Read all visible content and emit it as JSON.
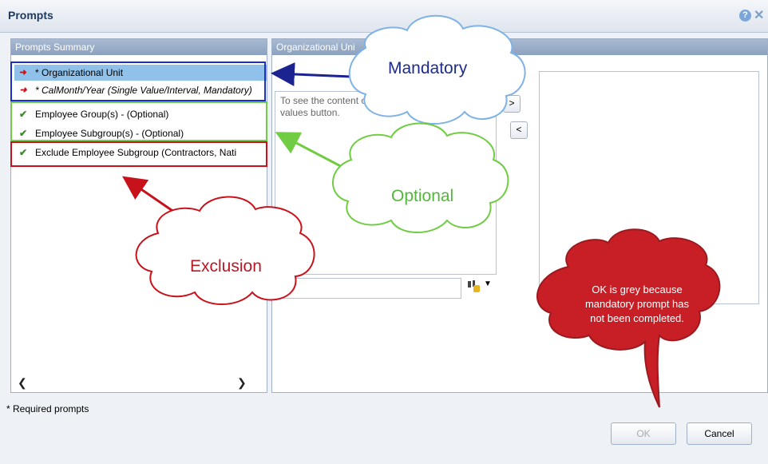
{
  "window": {
    "title": "Prompts"
  },
  "summary": {
    "header": "Prompts Summary",
    "rows": [
      {
        "marker": "➜",
        "text": "* Organizational Unit"
      },
      {
        "marker": "➜",
        "text": "* CalMonth/Year (Single Value/Interval, Mandatory)"
      },
      {
        "marker": "✔",
        "text": "Employee Group(s) - (Optional)"
      },
      {
        "marker": "✔",
        "text": "Employee Subgroup(s) - (Optional)"
      },
      {
        "marker": "✔",
        "text": "Exclude Employee Subgroup (Contractors, Nati"
      }
    ],
    "scroll_left": "❮",
    "scroll_right": "❯"
  },
  "values_panel": {
    "header": "Organizational Uni",
    "content_text": "To see the content of the list, click the Refresh values button.",
    "add_label": ">",
    "remove_label": "<"
  },
  "footer": {
    "note": "* Required prompts",
    "ok": "OK",
    "cancel": "Cancel"
  },
  "callouts": {
    "mandatory": "Mandatory",
    "optional": "Optional",
    "exclusion": "Exclusion",
    "ok_note": "OK is grey because mandatory prompt has not been completed."
  },
  "icons": {
    "help": "help-icon",
    "close": "close-icon",
    "search": "binoculars-icon",
    "dropdown": "dropdown-icon"
  },
  "colors": {
    "selection": "#8fc1ea",
    "mandatory_box": "#1a2fc7",
    "optional_box": "#6fcc43",
    "exclusion_box": "#c8121b",
    "cloud_red_fill": "#c81f26"
  }
}
